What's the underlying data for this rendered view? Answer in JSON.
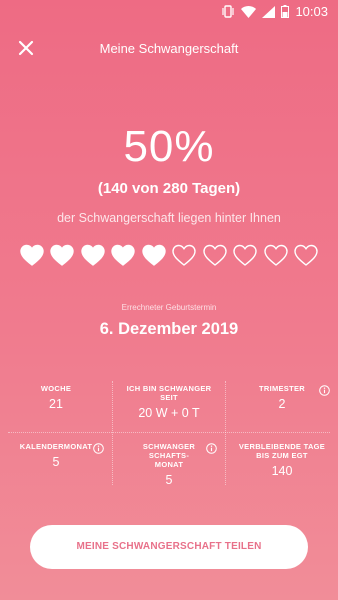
{
  "status_bar": {
    "time": "10:03",
    "icons": [
      "vibrate-icon",
      "wifi-icon",
      "signal-icon",
      "battery-icon"
    ]
  },
  "header": {
    "title": "Meine Schwangerschaft",
    "close_icon": "close-icon"
  },
  "progress": {
    "percent": "50%",
    "days_text": "(140 von 280 Tagen)",
    "subtitle": "der Schwangerschaft liegen hinter Ihnen",
    "hearts_total": 10,
    "hearts_filled": 5
  },
  "due": {
    "label": "Errechneter Geburtstermin",
    "date": "6. Dezember 2019"
  },
  "stats": [
    {
      "label": "WOCHE",
      "value": "21",
      "info": false
    },
    {
      "label": "ICH BIN SCHWANGER SEIT",
      "value": "20 W + 0 T",
      "info": false
    },
    {
      "label": "TRIMESTER",
      "value": "2",
      "info": true
    },
    {
      "label": "KALENDERMONAT",
      "value": "5",
      "info": true
    },
    {
      "label": "SCHWANGER SCHAFTS- MONAT",
      "value": "5",
      "info": true
    },
    {
      "label": "VERBLEIBENDE TAGE BIS ZUM EGT",
      "value": "140",
      "info": false
    }
  ],
  "share_button": {
    "label": "MEINE SCHWANGERSCHAFT TEILEN"
  },
  "colors": {
    "background": "#ee6b84",
    "button_text": "#e8718a"
  }
}
